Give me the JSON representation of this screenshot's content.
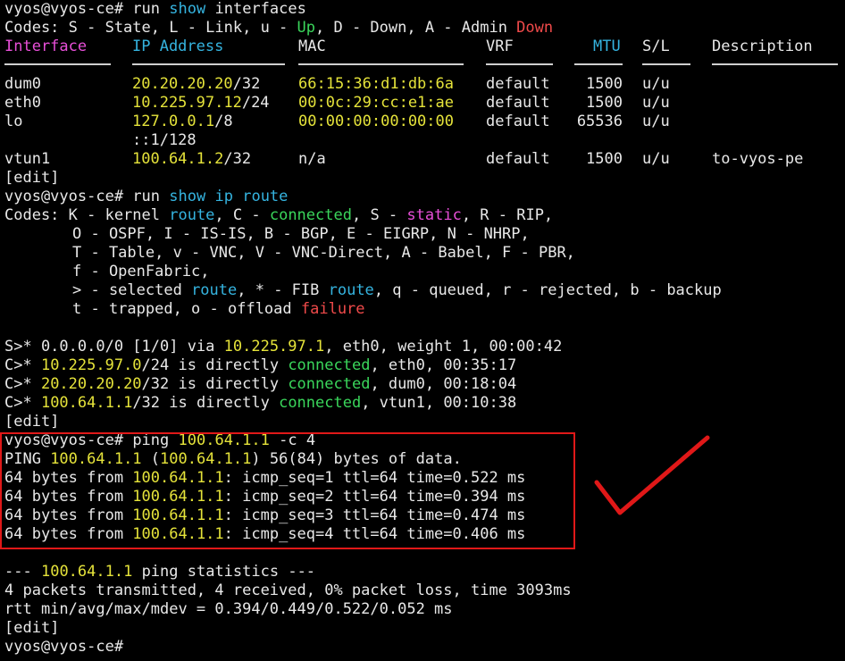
{
  "terminal": {
    "prompt": "vyos@vyos-ce#",
    "edit_marker": "[edit]",
    "cmd1": {
      "run": "run",
      "show": "show",
      "arg": "interfaces"
    },
    "codes1": {
      "prefix": "Codes: S - State, L - Link, u - ",
      "up": "Up",
      "mid": ", D - Down, A - Admin ",
      "down": "Down"
    },
    "if_headers": {
      "interface": "Interface",
      "ip": "IP Address",
      "mac": "MAC",
      "vrf": "VRF",
      "mtu": "MTU",
      "sl": "S/L",
      "desc": "Description"
    },
    "interfaces": [
      {
        "name": "dum0",
        "ip": "20.20.20.20",
        "mask": "/32",
        "mac": "66:15:36:d1:db:6a",
        "vrf": "default",
        "mtu": "1500",
        "sl": "u/u",
        "desc": ""
      },
      {
        "name": "eth0",
        "ip": "10.225.97.12",
        "mask": "/24",
        "mac": "00:0c:29:cc:e1:ae",
        "vrf": "default",
        "mtu": "1500",
        "sl": "u/u",
        "desc": ""
      },
      {
        "name": "lo",
        "ip": "127.0.0.1",
        "mask": "/8",
        "mac": "00:00:00:00:00:00",
        "vrf": "default",
        "mtu": "65536",
        "sl": "u/u",
        "desc": ""
      },
      {
        "name": "vtun1",
        "ip": "100.64.1.2",
        "mask": "/32",
        "mac": "n/a",
        "vrf": "default",
        "mtu": "1500",
        "sl": "u/u",
        "desc": "to-vyos-pe"
      }
    ],
    "lo_ipv6": "::1/128",
    "cmd2": {
      "run": "run",
      "show": "show",
      "ip": "ip",
      "route": "route"
    },
    "codes2": {
      "l1a": "Codes: K - kernel ",
      "l1route": "route",
      "l1b": ", C - ",
      "l1conn": "connected",
      "l1c": ", S - ",
      "l1static": "static",
      "l1d": ", R - RIP,",
      "l2": "O - OSPF, I - IS-IS, B - BGP, E - EIGRP, N - NHRP,",
      "l3": "T - Table, v - VNC, V - VNC-Direct, A - Babel, F - PBR,",
      "l4": "f - OpenFabric,",
      "l5a": "> - selected ",
      "l5route1": "route",
      "l5b": ", * - FIB ",
      "l5route2": "route",
      "l5c": ", q - queued, r - rejected, b - backup",
      "l6a": "t - trapped, o - offload ",
      "l6fail": "failure"
    },
    "routes": {
      "r1a": "S>* 0.0.0.0/0 [1/0] via ",
      "r1ip": "10.225.97.1",
      "r1b": ", eth0, weight 1, 00:00:42",
      "r2a": "C>* ",
      "r2ip": "10.225.97.0",
      "r2b": "/24 is directly ",
      "r2c": ", eth0, 00:35:17",
      "r3a": "C>* ",
      "r3ip": "20.20.20.20",
      "r3b": "/32 is directly ",
      "r3c": ", dum0, 00:18:04",
      "r4a": "C>* ",
      "r4ip": "100.64.1.1",
      "r4b": "/32 is directly ",
      "r4c": ", vtun1, 00:10:38",
      "connected": "connected"
    },
    "ping": {
      "cmd": "ping",
      "target": "100.64.1.1",
      "flag": "-c 4",
      "hdr_a": "PING ",
      "hdr_paren_open": " (",
      "hdr_paren_close": ")",
      "hdr_b": " 56(84) bytes of data.",
      "reply_prefix": "64 bytes from ",
      "replies": [
        ": icmp_seq=1 ttl=64 time=0.522 ms",
        ": icmp_seq=2 ttl=64 time=0.394 ms",
        ": icmp_seq=3 ttl=64 time=0.474 ms",
        ": icmp_seq=4 ttl=64 time=0.406 ms"
      ],
      "stats_dash1": "---",
      "stats_b": " ping statistics ",
      "stats_dash2": "---",
      "stats_line1": "4 packets transmitted, 4 received, 0% packet loss, time 3093ms",
      "stats_line2": "rtt min/avg/max/mdev = 0.394/0.449/0.522/0.052 ms"
    }
  },
  "colors": {
    "background": "#000000",
    "text": "#e8e8e8",
    "yellow": "#e5e33a",
    "blue": "#35b4e0",
    "green": "#3ad65b",
    "magenta": "#e84fd8",
    "red": "#f04a4a",
    "annotation": "#e01818"
  }
}
